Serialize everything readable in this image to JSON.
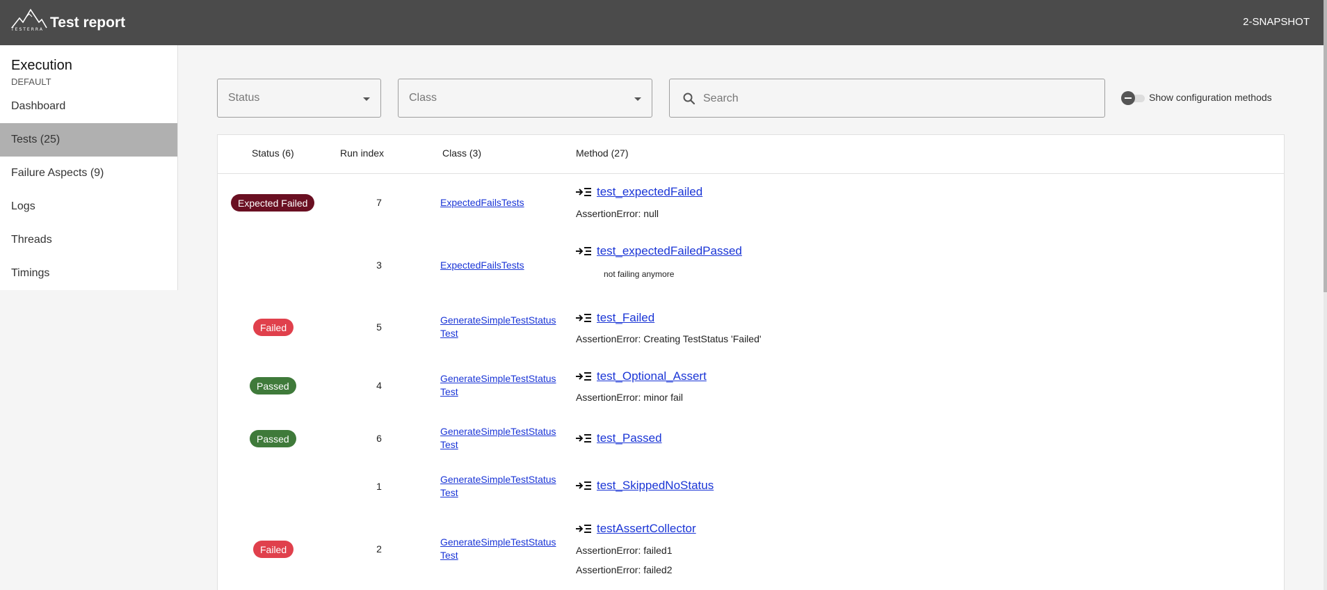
{
  "header": {
    "logo_text": "TESTERRA",
    "title": "Test report",
    "version": "2-SNAPSHOT"
  },
  "sidebar": {
    "heading": "Execution",
    "subheading": "DEFAULT",
    "items": [
      {
        "label": "Dashboard",
        "icon": "none"
      },
      {
        "label": "Tests (25)",
        "active": true
      },
      {
        "label": "Failure Aspects (9)"
      },
      {
        "label": "Logs"
      },
      {
        "label": "Threads"
      },
      {
        "label": "Timings"
      }
    ]
  },
  "filters": {
    "status_placeholder": "Status",
    "class_placeholder": "Class",
    "search_placeholder": "Search",
    "toggle_label": "Show configuration methods"
  },
  "table": {
    "headers": {
      "status": "Status (6)",
      "run_index": "Run index",
      "class": "Class (3)",
      "method": "Method (27)"
    },
    "rows": [
      {
        "status": "Expected Failed",
        "run_index": "7",
        "class": "ExpectedFailsTests",
        "method": "test_expectedFailed",
        "messages": [
          "AssertionError: null"
        ]
      },
      {
        "status": "",
        "run_index": "3",
        "class": "ExpectedFailsTests",
        "method": "test_expectedFailedPassed",
        "messages": [
          "not failing anymore"
        ]
      },
      {
        "status": "Failed",
        "run_index": "5",
        "class": "GenerateSimpleTestStatusTest",
        "method": "test_Failed",
        "messages": [
          "AssertionError: Creating TestStatus 'Failed'"
        ]
      },
      {
        "status": "Passed",
        "run_index": "4",
        "class": "GenerateSimpleTestStatusTest",
        "method": "test_Optional_Assert",
        "messages": [
          "AssertionError: minor fail"
        ]
      },
      {
        "status": "Passed",
        "run_index": "6",
        "class": "GenerateSimpleTestStatusTest",
        "method": "test_Passed",
        "messages": []
      },
      {
        "status": "",
        "run_index": "1",
        "class": "GenerateSimpleTestStatusTest",
        "method": "test_SkippedNoStatus",
        "messages": []
      },
      {
        "status": "Failed",
        "run_index": "2",
        "class": "GenerateSimpleTestStatusTest",
        "method": "testAssertCollector",
        "messages": [
          "AssertionError: failed1",
          "AssertionError: failed2"
        ]
      }
    ]
  },
  "colors": {
    "topbar": "#4b4b4b",
    "expected_failed": "#6a0f22",
    "failed": "#e0404c",
    "passed": "#3f7a3a",
    "link": "#1a35d6"
  }
}
